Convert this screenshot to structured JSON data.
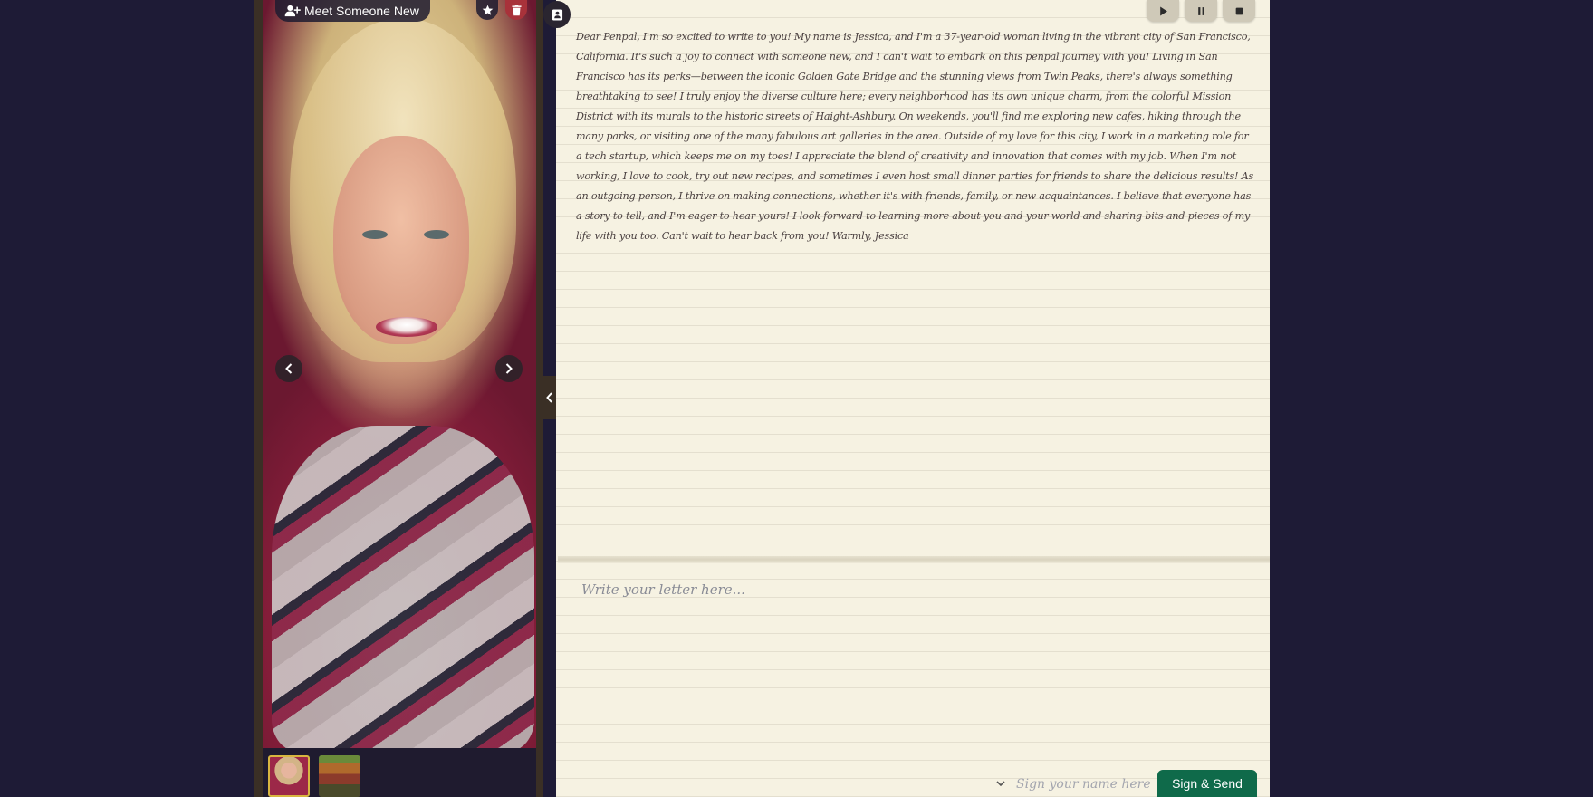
{
  "profile": {
    "meet_button_label": "Meet Someone New"
  },
  "icons": {
    "add_user": "person-plus-icon",
    "favorite": "star-icon",
    "delete": "trash-icon",
    "prev": "chevron-left-icon",
    "next": "chevron-right-icon",
    "collapse": "chevron-left-icon",
    "profile_card": "contact-card-icon",
    "play": "play-icon",
    "pause": "pause-icon",
    "stop": "stop-icon",
    "signature_dropdown": "chevron-down-icon"
  },
  "colors": {
    "delete_button": "#a8323a",
    "send_button": "#0f6a4a",
    "selected_thumbnail_border": "#d8b640",
    "paper": "#f6f2e2",
    "background": "#1e1b36"
  },
  "thumbnails": [
    {
      "name": "portrait",
      "selected": true
    },
    {
      "name": "house",
      "selected": false
    }
  ],
  "letter": {
    "text": "Dear Penpal, I'm so excited to write to you! My name is Jessica, and I'm a 37-year-old woman living in the vibrant city of San Francisco, California. It's such a joy to connect with someone new, and I can't wait to embark on this penpal journey with you! Living in San Francisco has its perks—between the iconic Golden Gate Bridge and the stunning views from Twin Peaks, there's always something breathtaking to see! I truly enjoy the diverse culture here; every neighborhood has its own unique charm, from the colorful Mission District with its murals to the historic streets of Haight-Ashbury. On weekends, you'll find me exploring new cafes, hiking through the many parks, or visiting one of the many fabulous art galleries in the area. Outside of my love for this city, I work in a marketing role for a tech startup, which keeps me on my toes! I appreciate the blend of creativity and innovation that comes with my job. When I'm not working, I love to cook, try out new recipes, and sometimes I even host small dinner parties for friends to share the delicious results! As an outgoing person, I thrive on making connections, whether it's with friends, family, or new acquaintances. I believe that everyone has a story to tell, and I'm eager to hear yours! I look forward to learning more about you and your world and sharing bits and pieces of my life with you too. Can't wait to hear back from you! Warmly,  Jessica"
  },
  "compose": {
    "placeholder": "Write your letter here...",
    "value": ""
  },
  "signature": {
    "placeholder": "Sign your name here",
    "value": ""
  },
  "send_button_label": "Sign & Send"
}
